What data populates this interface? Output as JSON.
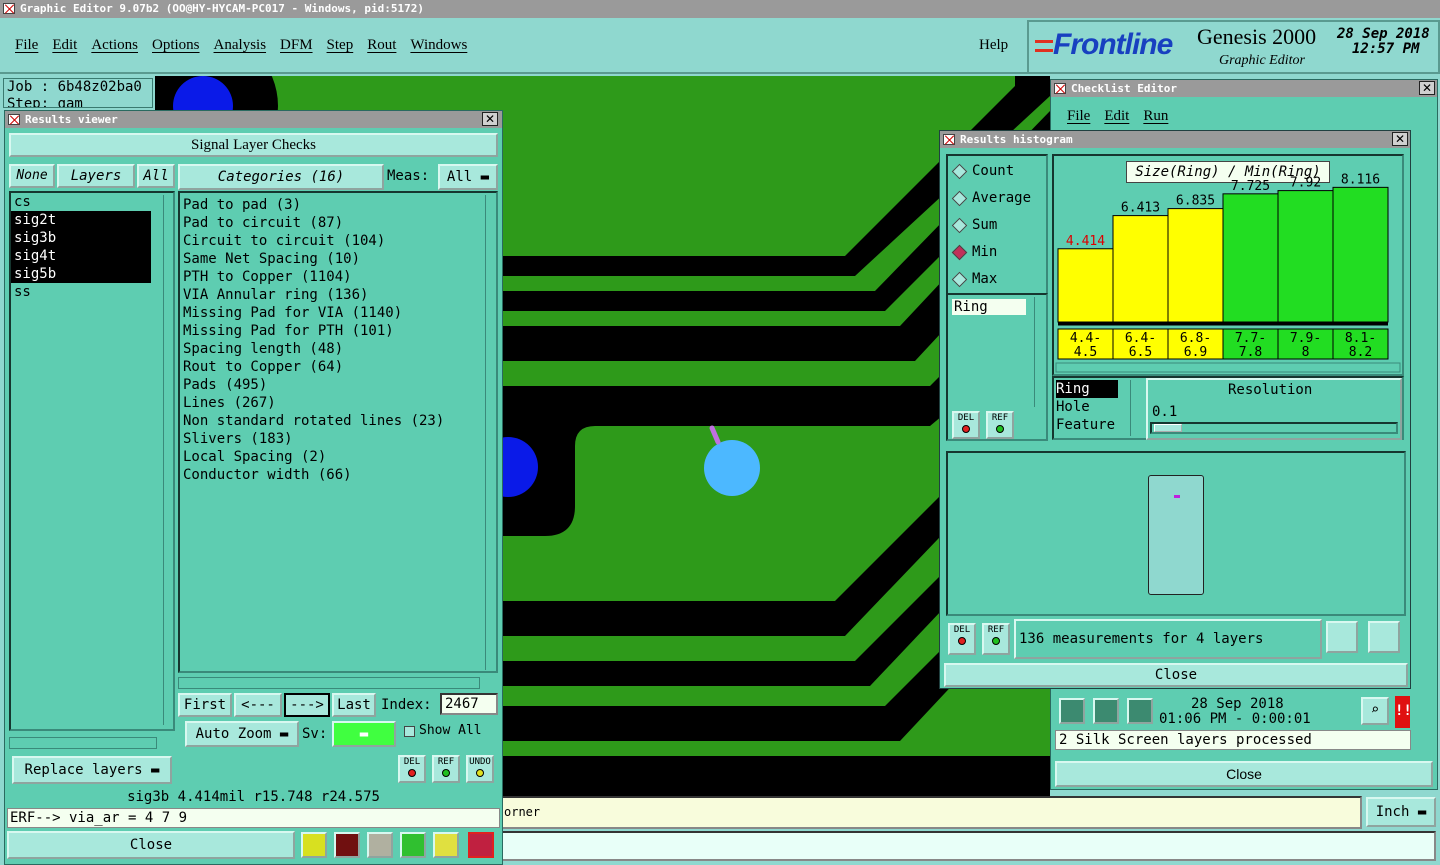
{
  "app": {
    "title": "Graphic Editor 9.07b2 (OO@HY-HYCAM-PC017 - Windows, pid:5172)",
    "menu": [
      "File",
      "Edit",
      "Actions",
      "Options",
      "Analysis",
      "DFM",
      "Step",
      "Rout",
      "Windows"
    ],
    "help": "Help",
    "brand": "Frontline",
    "product": "Genesis 2000",
    "subtitle": "Graphic Editor",
    "date": "28 Sep 2018",
    "time": "12:57 PM"
  },
  "job": {
    "job_label": "Job : 6b48z02ba0",
    "step_label": "Step: gam"
  },
  "results_viewer": {
    "title": "Results viewer",
    "header": "Signal Layer Checks",
    "none_btn": "None",
    "layers_btn": "Layers",
    "all_btn": "All",
    "categories_btn": "Categories (16)",
    "meas_label": "Meas:",
    "meas_value": "All",
    "layers": [
      "cs",
      "sig2t",
      "sig3b",
      "sig4t",
      "sig5b",
      "ss"
    ],
    "categories": [
      "Pad to pad (3)",
      "Pad to circuit (87)",
      "Circuit to circuit (104)",
      "Same Net Spacing (10)",
      "PTH to Copper (1104)",
      "VIA Annular ring (136)",
      "Missing Pad for VIA (1140)",
      "Missing Pad for PTH (101)",
      "Spacing length (48)",
      "Rout to Copper (64)",
      "Pads (495)",
      "Lines (267)",
      "Non standard rotated lines (23)",
      "Slivers (183)",
      "Local Spacing (2)",
      "Conductor width (66)"
    ],
    "first": "First",
    "prev": "<---",
    "next": "--->",
    "last": "Last",
    "index_label": "Index:",
    "index_value": "2467",
    "auto_zoom": "Auto Zoom",
    "sv_label": "Sv:",
    "show_all": "Show All",
    "replace_layers": "Replace layers",
    "del": "DEL",
    "ref": "REF",
    "undo": "UNDO",
    "status": "sig3b 4.414mil  r15.748  r24.575",
    "erf": "ERF--> via_ar = 4 7 9",
    "close": "Close"
  },
  "checklist": {
    "title": "Checklist Editor",
    "menu": [
      "File",
      "Edit",
      "Run"
    ],
    "date": "28 Sep 2018",
    "time": "01:06 PM - 0:00:01",
    "status": "2 Silk Screen layers processed",
    "close": "Close"
  },
  "histogram": {
    "title": "Results histogram",
    "modes": [
      "Count",
      "Average",
      "Sum",
      "Min",
      "Max"
    ],
    "selected_mode": "Min",
    "chart_title": "Size(Ring) / Min(Ring)",
    "left_list": [
      "Ring"
    ],
    "del": "DEL",
    "ref": "REF",
    "measure_list": [
      "Ring",
      "Hole",
      "Feature"
    ],
    "resolution_label": "Resolution",
    "resolution_value": "0.1",
    "summary": "136 measurements for 4 layers",
    "close": "Close"
  },
  "chart_data": {
    "type": "bar",
    "title": "Size(Ring) / Min(Ring)",
    "categories": [
      "4.4-4.5",
      "6.4-6.5",
      "6.8-6.9",
      "7.7-7.8",
      "7.9-8",
      "8.1-8.2"
    ],
    "cat_lines": [
      [
        "4.4-",
        "4.5"
      ],
      [
        "6.4-",
        "6.5"
      ],
      [
        "6.8-",
        "6.9"
      ],
      [
        "7.7-",
        "7.8"
      ],
      [
        "7.9-",
        "8"
      ],
      [
        "8.1-",
        "8.2"
      ]
    ],
    "values": [
      4.414,
      6.413,
      6.835,
      7.725,
      7.92,
      8.116
    ],
    "labels": [
      "4.414",
      "6.413",
      "6.835",
      "7.725",
      "7.92",
      "8.116"
    ],
    "colors": [
      "#ffff00",
      "#ffff00",
      "#ffff00",
      "#22dd22",
      "#22dd22",
      "#22dd22"
    ],
    "label_colors": [
      "#dd0000",
      "#000000",
      "#000000",
      "#000000",
      "#000000",
      "#000000"
    ],
    "ylim": [
      0,
      8.8
    ]
  },
  "footer": {
    "cmd_text": "orner",
    "units": "Inch"
  }
}
